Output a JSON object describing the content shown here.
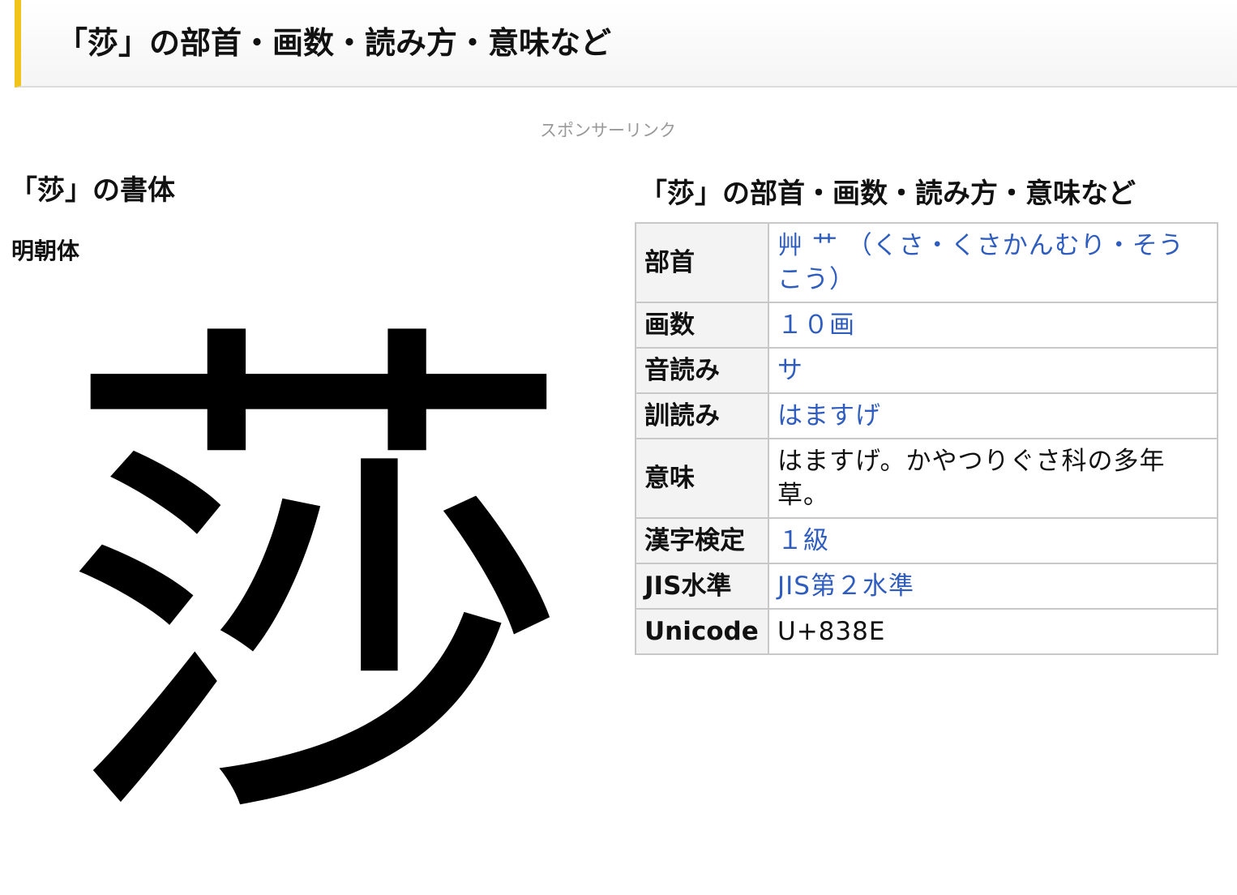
{
  "header": {
    "title": "「莎」の部首・画数・読み方・意味など"
  },
  "sponsor": {
    "label": "スポンサーリンク"
  },
  "font_section": {
    "heading": "「莎」の書体",
    "style_label": "明朝体",
    "character": "莎"
  },
  "info_section": {
    "heading": "「莎」の部首・画数・読み方・意味など",
    "rows": [
      {
        "label": "部首",
        "value": "艸 艹 （くさ・くさかんむり・そうこう）",
        "link": true
      },
      {
        "label": "画数",
        "value": "１０画",
        "link": true
      },
      {
        "label": "音読み",
        "value": "サ",
        "link": true
      },
      {
        "label": "訓読み",
        "value": "はますげ",
        "link": true
      },
      {
        "label": "意味",
        "value": "はますげ。かやつりぐさ科の多年草。",
        "link": false
      },
      {
        "label": "漢字検定",
        "value": "１級",
        "link": true
      },
      {
        "label": "JIS水準",
        "value": "JIS第２水準",
        "link": true
      },
      {
        "label": "Unicode",
        "value": "U+838E",
        "link": false
      }
    ]
  },
  "colors": {
    "accent": "#f0c419",
    "link": "#2f5dbf",
    "table_border": "#c8c8c8",
    "header_cell_bg": "#f3f3f3"
  }
}
